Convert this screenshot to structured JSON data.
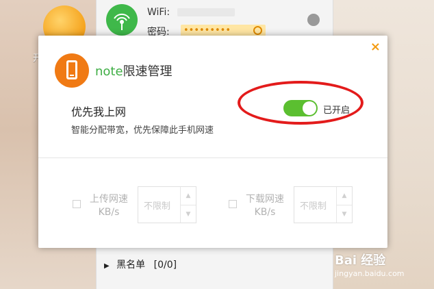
{
  "background": {
    "caption": "开启"
  },
  "wifi_panel": {
    "wifi_label": "WiFi:",
    "password_label": "密码:",
    "password_mask": "•••••••••"
  },
  "blacklist": {
    "label": "黑名单",
    "count": "[0/0]"
  },
  "watermark": {
    "brand": "Bai 经验",
    "url": "jingyan.baidu.com"
  },
  "dialog": {
    "title_brand": "note",
    "title_rest": "限速管理",
    "close_label": "×",
    "priority": {
      "title": "优先我上网",
      "description": "智能分配带宽，优先保障此手机网速",
      "status": "已开启",
      "enabled": true
    },
    "upload": {
      "label_line1": "上传网速",
      "label_line2": "KB/s",
      "value": "不限制"
    },
    "download": {
      "label_line1": "下载网速",
      "label_line2": "KB/s",
      "value": "不限制"
    }
  },
  "colors": {
    "accent_green": "#5bbf30",
    "brand_orange": "#f07a14",
    "annotation_red": "#e31b1b"
  },
  "icons": [
    "wifi-logo-icon",
    "wifi-icon",
    "eye-icon",
    "edit-icon",
    "phone-icon",
    "close-icon",
    "spinner-up-icon",
    "spinner-down-icon",
    "triangle-right-icon"
  ]
}
